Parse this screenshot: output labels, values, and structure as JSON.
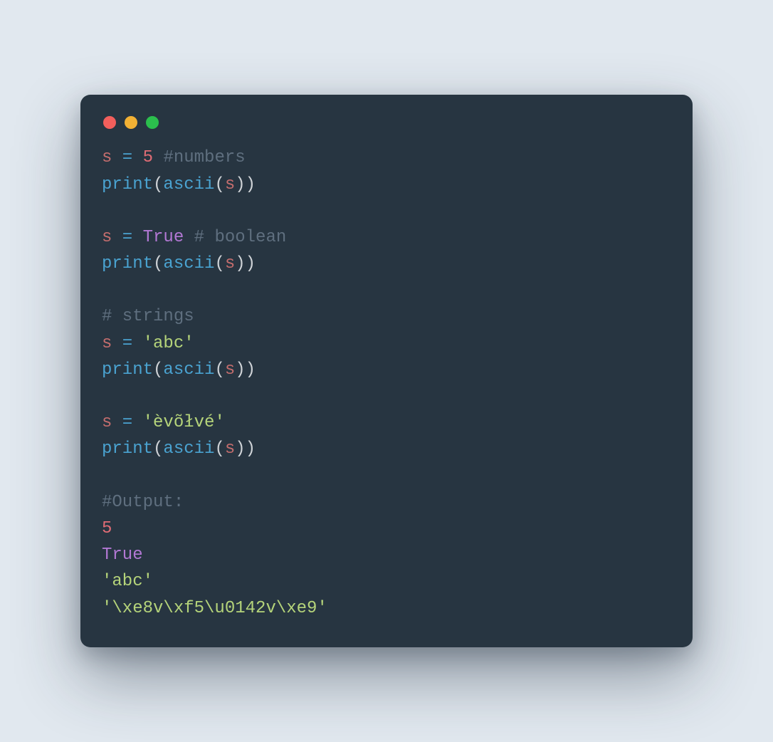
{
  "window": {
    "traffic_lights": [
      "close",
      "minimize",
      "zoom"
    ]
  },
  "code": {
    "l1": {
      "var": "s",
      "eq": " = ",
      "num": "5",
      "sp": " ",
      "comment": "#numbers"
    },
    "l2": {
      "fn1": "print",
      "p1": "(",
      "fn2": "ascii",
      "p2": "(",
      "arg": "s",
      "p3": ")",
      "p4": ")"
    },
    "l3": "",
    "l4": {
      "var": "s",
      "eq": " = ",
      "kw": "True",
      "sp": " ",
      "comment": "# boolean"
    },
    "l5": {
      "fn1": "print",
      "p1": "(",
      "fn2": "ascii",
      "p2": "(",
      "arg": "s",
      "p3": ")",
      "p4": ")"
    },
    "l6": "",
    "l7": {
      "comment": "# strings"
    },
    "l8": {
      "var": "s",
      "eq": " = ",
      "str": "'abc'"
    },
    "l9": {
      "fn1": "print",
      "p1": "(",
      "fn2": "ascii",
      "p2": "(",
      "arg": "s",
      "p3": ")",
      "p4": ")"
    },
    "l10": "",
    "l11": {
      "var": "s",
      "eq": " = ",
      "str": "'èvõłvé'"
    },
    "l12": {
      "fn1": "print",
      "p1": "(",
      "fn2": "ascii",
      "p2": "(",
      "arg": "s",
      "p3": ")",
      "p4": ")"
    },
    "l13": "",
    "l14": {
      "comment": "#Output:"
    },
    "l15": {
      "num": "5"
    },
    "l16": {
      "kw": "True"
    },
    "l17": {
      "str": "'abc'"
    },
    "l18": {
      "str": "'\\xe8v\\xf5\\u0142v\\xe9'"
    }
  }
}
